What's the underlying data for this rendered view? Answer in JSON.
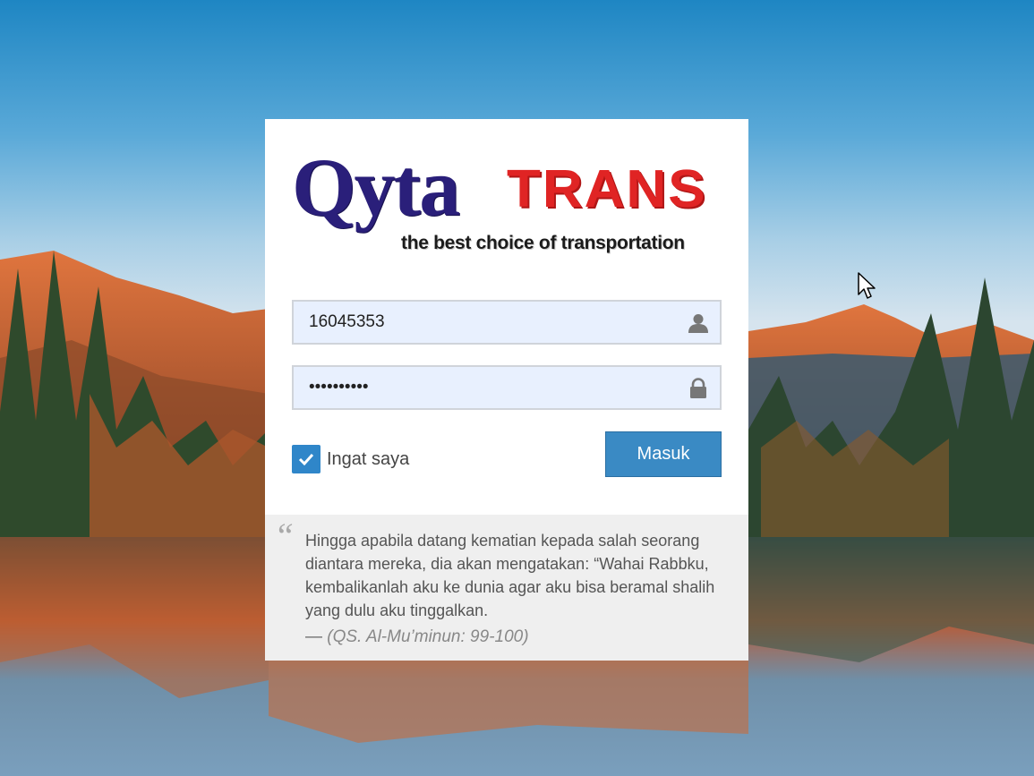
{
  "logo": {
    "brand_primary": "Qyta",
    "brand_secondary": "TRANS",
    "tagline": "the best choice of transportation"
  },
  "login": {
    "username_value": "16045353",
    "password_value": "••••••••••",
    "remember_label": "Ingat saya",
    "remember_checked": true,
    "submit_label": "Masuk"
  },
  "quote": {
    "mark": "“",
    "text": "Hingga apabila datang kematian kepada salah seorang diantara mereka, dia akan mengatakan: “Wahai Rabbku, kembalikanlah aku ke dunia agar aku bisa beramal shalih yang dulu aku tinggalkan.",
    "dash": "—",
    "source": "(QS. Al-Mu’minun: 99-100)"
  },
  "colors": {
    "brand_navy": "#2a1f7a",
    "brand_red": "#e02424",
    "button_blue": "#3a8ac4",
    "checkbox_blue": "#2f86c9",
    "input_bg": "#e8f0fe",
    "quote_bg": "#efefef"
  },
  "icons": {
    "username_field": "user-icon",
    "password_field": "lock-icon",
    "checkbox": "check-icon"
  }
}
